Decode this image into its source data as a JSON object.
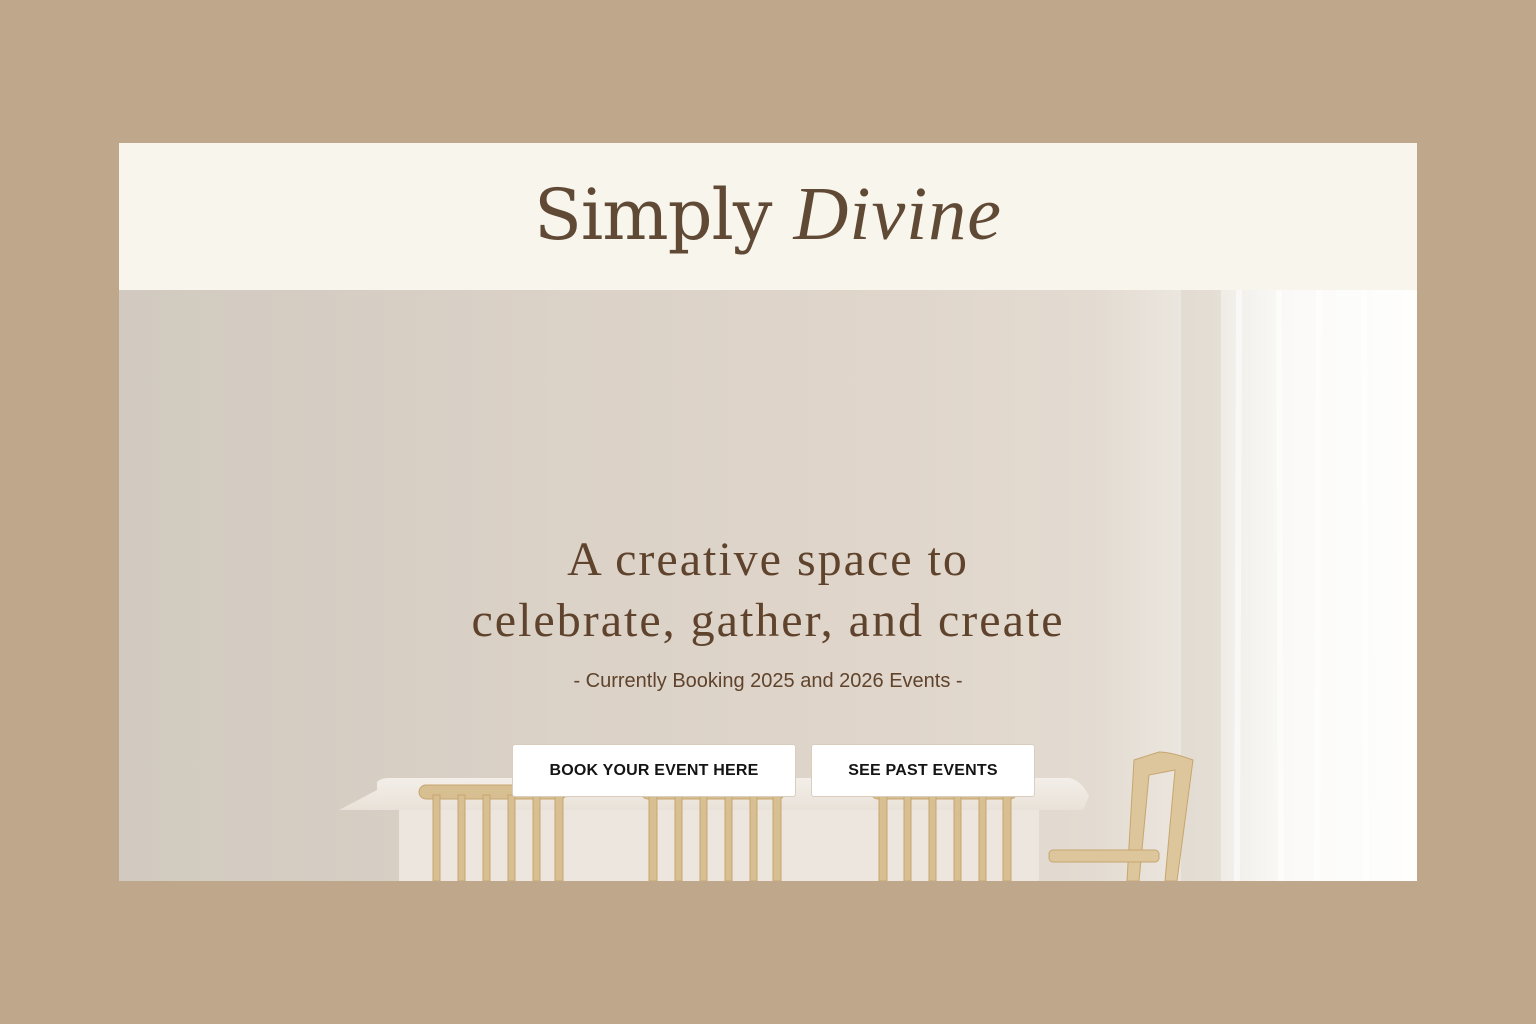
{
  "header": {
    "logo_part1": "Simply",
    "logo_part2": "Divine"
  },
  "hero": {
    "headline_line1": "A creative space to",
    "headline_line2": "celebrate, gather, and create",
    "subline": "- Currently Booking 2025 and 2026 Events -",
    "buttons": {
      "book_label": "BOOK YOUR EVENT HERE",
      "past_label": "SEE PAST EVENTS"
    }
  },
  "colors": {
    "page_background": "#bfa78b",
    "header_background": "#f8f5ec",
    "brand_brown": "#614a35",
    "button_background": "#ffffff",
    "button_text": "#141414"
  }
}
